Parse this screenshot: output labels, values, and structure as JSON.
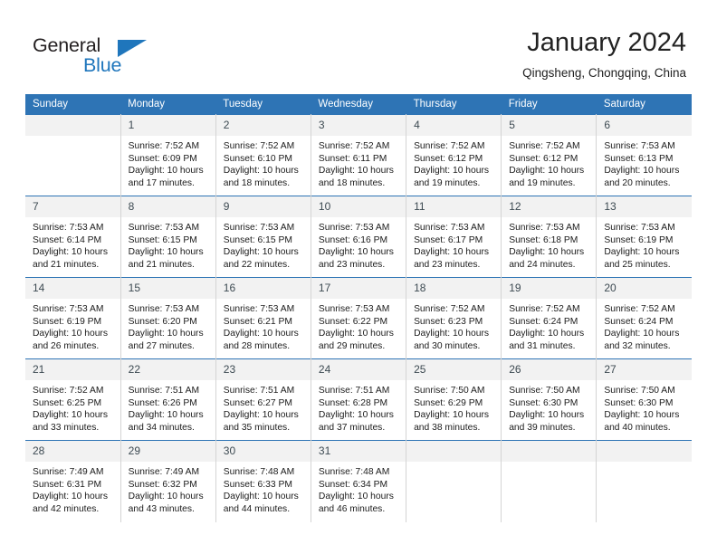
{
  "logo": {
    "word_one": "General",
    "word_two": "Blue",
    "triangle_color": "#1f76bc",
    "text_color": "#231f20"
  },
  "header": {
    "title": "January 2024",
    "subtitle": "Qingsheng, Chongqing, China"
  },
  "colors": {
    "header_bar": "#2e74b5",
    "daynum_strip": "#f2f2f2",
    "daynum_text": "#3d4a52",
    "cell_text": "#1b1b1b",
    "cell_divider": "#d4d4d4"
  },
  "weekdays": [
    "Sunday",
    "Monday",
    "Tuesday",
    "Wednesday",
    "Thursday",
    "Friday",
    "Saturday"
  ],
  "weeks": [
    [
      {
        "day": "",
        "sunrise": "",
        "sunset": "",
        "daylight_line1": "",
        "daylight_line2": ""
      },
      {
        "day": "1",
        "sunrise": "Sunrise: 7:52 AM",
        "sunset": "Sunset: 6:09 PM",
        "daylight_line1": "Daylight: 10 hours",
        "daylight_line2": "and 17 minutes."
      },
      {
        "day": "2",
        "sunrise": "Sunrise: 7:52 AM",
        "sunset": "Sunset: 6:10 PM",
        "daylight_line1": "Daylight: 10 hours",
        "daylight_line2": "and 18 minutes."
      },
      {
        "day": "3",
        "sunrise": "Sunrise: 7:52 AM",
        "sunset": "Sunset: 6:11 PM",
        "daylight_line1": "Daylight: 10 hours",
        "daylight_line2": "and 18 minutes."
      },
      {
        "day": "4",
        "sunrise": "Sunrise: 7:52 AM",
        "sunset": "Sunset: 6:12 PM",
        "daylight_line1": "Daylight: 10 hours",
        "daylight_line2": "and 19 minutes."
      },
      {
        "day": "5",
        "sunrise": "Sunrise: 7:52 AM",
        "sunset": "Sunset: 6:12 PM",
        "daylight_line1": "Daylight: 10 hours",
        "daylight_line2": "and 19 minutes."
      },
      {
        "day": "6",
        "sunrise": "Sunrise: 7:53 AM",
        "sunset": "Sunset: 6:13 PM",
        "daylight_line1": "Daylight: 10 hours",
        "daylight_line2": "and 20 minutes."
      }
    ],
    [
      {
        "day": "7",
        "sunrise": "Sunrise: 7:53 AM",
        "sunset": "Sunset: 6:14 PM",
        "daylight_line1": "Daylight: 10 hours",
        "daylight_line2": "and 21 minutes."
      },
      {
        "day": "8",
        "sunrise": "Sunrise: 7:53 AM",
        "sunset": "Sunset: 6:15 PM",
        "daylight_line1": "Daylight: 10 hours",
        "daylight_line2": "and 21 minutes."
      },
      {
        "day": "9",
        "sunrise": "Sunrise: 7:53 AM",
        "sunset": "Sunset: 6:15 PM",
        "daylight_line1": "Daylight: 10 hours",
        "daylight_line2": "and 22 minutes."
      },
      {
        "day": "10",
        "sunrise": "Sunrise: 7:53 AM",
        "sunset": "Sunset: 6:16 PM",
        "daylight_line1": "Daylight: 10 hours",
        "daylight_line2": "and 23 minutes."
      },
      {
        "day": "11",
        "sunrise": "Sunrise: 7:53 AM",
        "sunset": "Sunset: 6:17 PM",
        "daylight_line1": "Daylight: 10 hours",
        "daylight_line2": "and 23 minutes."
      },
      {
        "day": "12",
        "sunrise": "Sunrise: 7:53 AM",
        "sunset": "Sunset: 6:18 PM",
        "daylight_line1": "Daylight: 10 hours",
        "daylight_line2": "and 24 minutes."
      },
      {
        "day": "13",
        "sunrise": "Sunrise: 7:53 AM",
        "sunset": "Sunset: 6:19 PM",
        "daylight_line1": "Daylight: 10 hours",
        "daylight_line2": "and 25 minutes."
      }
    ],
    [
      {
        "day": "14",
        "sunrise": "Sunrise: 7:53 AM",
        "sunset": "Sunset: 6:19 PM",
        "daylight_line1": "Daylight: 10 hours",
        "daylight_line2": "and 26 minutes."
      },
      {
        "day": "15",
        "sunrise": "Sunrise: 7:53 AM",
        "sunset": "Sunset: 6:20 PM",
        "daylight_line1": "Daylight: 10 hours",
        "daylight_line2": "and 27 minutes."
      },
      {
        "day": "16",
        "sunrise": "Sunrise: 7:53 AM",
        "sunset": "Sunset: 6:21 PM",
        "daylight_line1": "Daylight: 10 hours",
        "daylight_line2": "and 28 minutes."
      },
      {
        "day": "17",
        "sunrise": "Sunrise: 7:53 AM",
        "sunset": "Sunset: 6:22 PM",
        "daylight_line1": "Daylight: 10 hours",
        "daylight_line2": "and 29 minutes."
      },
      {
        "day": "18",
        "sunrise": "Sunrise: 7:52 AM",
        "sunset": "Sunset: 6:23 PM",
        "daylight_line1": "Daylight: 10 hours",
        "daylight_line2": "and 30 minutes."
      },
      {
        "day": "19",
        "sunrise": "Sunrise: 7:52 AM",
        "sunset": "Sunset: 6:24 PM",
        "daylight_line1": "Daylight: 10 hours",
        "daylight_line2": "and 31 minutes."
      },
      {
        "day": "20",
        "sunrise": "Sunrise: 7:52 AM",
        "sunset": "Sunset: 6:24 PM",
        "daylight_line1": "Daylight: 10 hours",
        "daylight_line2": "and 32 minutes."
      }
    ],
    [
      {
        "day": "21",
        "sunrise": "Sunrise: 7:52 AM",
        "sunset": "Sunset: 6:25 PM",
        "daylight_line1": "Daylight: 10 hours",
        "daylight_line2": "and 33 minutes."
      },
      {
        "day": "22",
        "sunrise": "Sunrise: 7:51 AM",
        "sunset": "Sunset: 6:26 PM",
        "daylight_line1": "Daylight: 10 hours",
        "daylight_line2": "and 34 minutes."
      },
      {
        "day": "23",
        "sunrise": "Sunrise: 7:51 AM",
        "sunset": "Sunset: 6:27 PM",
        "daylight_line1": "Daylight: 10 hours",
        "daylight_line2": "and 35 minutes."
      },
      {
        "day": "24",
        "sunrise": "Sunrise: 7:51 AM",
        "sunset": "Sunset: 6:28 PM",
        "daylight_line1": "Daylight: 10 hours",
        "daylight_line2": "and 37 minutes."
      },
      {
        "day": "25",
        "sunrise": "Sunrise: 7:50 AM",
        "sunset": "Sunset: 6:29 PM",
        "daylight_line1": "Daylight: 10 hours",
        "daylight_line2": "and 38 minutes."
      },
      {
        "day": "26",
        "sunrise": "Sunrise: 7:50 AM",
        "sunset": "Sunset: 6:30 PM",
        "daylight_line1": "Daylight: 10 hours",
        "daylight_line2": "and 39 minutes."
      },
      {
        "day": "27",
        "sunrise": "Sunrise: 7:50 AM",
        "sunset": "Sunset: 6:30 PM",
        "daylight_line1": "Daylight: 10 hours",
        "daylight_line2": "and 40 minutes."
      }
    ],
    [
      {
        "day": "28",
        "sunrise": "Sunrise: 7:49 AM",
        "sunset": "Sunset: 6:31 PM",
        "daylight_line1": "Daylight: 10 hours",
        "daylight_line2": "and 42 minutes."
      },
      {
        "day": "29",
        "sunrise": "Sunrise: 7:49 AM",
        "sunset": "Sunset: 6:32 PM",
        "daylight_line1": "Daylight: 10 hours",
        "daylight_line2": "and 43 minutes."
      },
      {
        "day": "30",
        "sunrise": "Sunrise: 7:48 AM",
        "sunset": "Sunset: 6:33 PM",
        "daylight_line1": "Daylight: 10 hours",
        "daylight_line2": "and 44 minutes."
      },
      {
        "day": "31",
        "sunrise": "Sunrise: 7:48 AM",
        "sunset": "Sunset: 6:34 PM",
        "daylight_line1": "Daylight: 10 hours",
        "daylight_line2": "and 46 minutes."
      },
      {
        "day": "",
        "sunrise": "",
        "sunset": "",
        "daylight_line1": "",
        "daylight_line2": ""
      },
      {
        "day": "",
        "sunrise": "",
        "sunset": "",
        "daylight_line1": "",
        "daylight_line2": ""
      },
      {
        "day": "",
        "sunrise": "",
        "sunset": "",
        "daylight_line1": "",
        "daylight_line2": ""
      }
    ]
  ]
}
